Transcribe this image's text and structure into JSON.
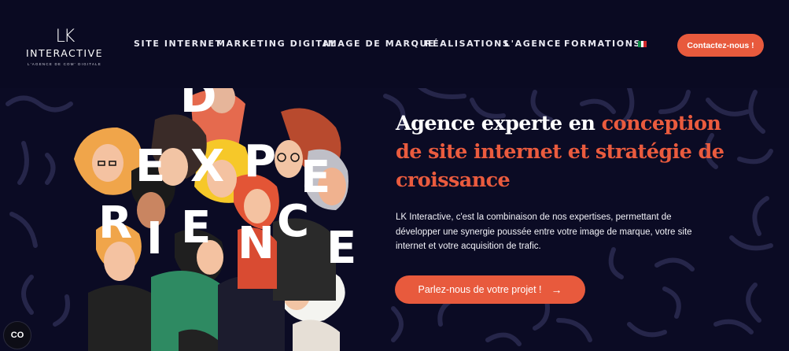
{
  "brand": {
    "mark": "LK",
    "name": "INTERACTIVE",
    "tagline": "L'AGENCE DE COM' DIGITALE"
  },
  "nav": {
    "items": [
      {
        "label": "SITE INTERNET"
      },
      {
        "label": "MARKETING DIGITAL"
      },
      {
        "label": "IMAGE DE MARQUE"
      },
      {
        "label": "RÉALISATIONS"
      },
      {
        "label": "L'AGENCE"
      },
      {
        "label": "FORMATIONS"
      }
    ],
    "language_flag_icon": "mexico-flag-icon",
    "contact_label": "Contactez-nous !"
  },
  "hero": {
    "headline_part1": "Agence experte en ",
    "headline_accent": "conception de site internet et stratégie de croissance",
    "description": "LK Interactive, c'est la combinaison de nos expertises, permettant de développer une synergie poussée entre votre image de marque, votre site internet et votre acquisition de trafic.",
    "cta_label": "Parlez-nous de votre projet !",
    "cta_icon": "arrow-right-icon",
    "illustration_letters": [
      "D",
      "E",
      "X",
      "P",
      "E",
      "R",
      "I",
      "E",
      "N",
      "C",
      "E",
      "E"
    ]
  },
  "chat": {
    "label": "CO"
  },
  "colors": {
    "background": "#0b0b24",
    "accent": "#e85a3d",
    "text": "#ffffff"
  }
}
